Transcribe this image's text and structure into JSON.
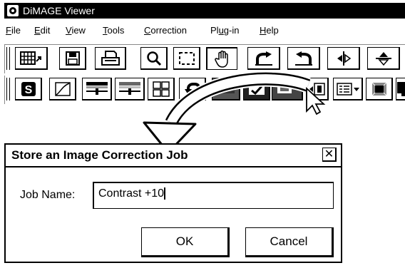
{
  "app": {
    "title": "DiMAGE Viewer"
  },
  "menu": [
    {
      "label": "File",
      "underline": "F"
    },
    {
      "label": "Edit",
      "underline": "E"
    },
    {
      "label": "View",
      "underline": "V"
    },
    {
      "label": "Tools",
      "underline": "T"
    },
    {
      "label": "Correction",
      "underline": "C"
    },
    {
      "label": "Plug-in",
      "underline": "u"
    },
    {
      "label": "Help",
      "underline": "H"
    }
  ],
  "toolbar1": [
    "thumbnail-view-icon",
    "save-icon",
    "print-icon",
    "magnifier-icon",
    "selection-icon",
    "hand-icon",
    "rotate-left-icon",
    "rotate-right-icon",
    "flip-horizontal-icon",
    "flip-vertical-icon"
  ],
  "toolbar2": [
    "color-sync-icon",
    "tone-curve-icon",
    "brightness-contrast-icon",
    "color-balance-icon",
    "variations-icon",
    "undo-icon",
    "compare-icon",
    "save-job-icon",
    "load-job-icon",
    "store-job-icon",
    "job-list-icon",
    "gradient-icon",
    "monitor-icon"
  ],
  "dialog": {
    "title": "Store an Image Correction Job",
    "close": "✕",
    "job_name_label": "Job Name:",
    "job_name_value": "Contrast +10",
    "ok": "OK",
    "cancel": "Cancel"
  },
  "colors": {
    "ink": "#000000",
    "paper": "#ffffff"
  }
}
